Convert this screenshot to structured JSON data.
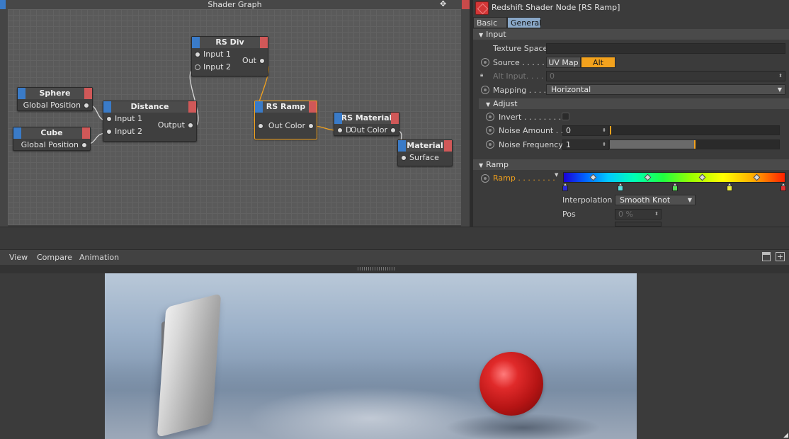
{
  "graph": {
    "title": "Shader Graph",
    "move_icon": "✥",
    "nodes": {
      "sphere": {
        "title": "Sphere",
        "out": "Global Position"
      },
      "cube": {
        "title": "Cube",
        "out": "Global Position"
      },
      "distance": {
        "title": "Distance",
        "in1": "Input 1",
        "in2": "Input 2",
        "out": "Output"
      },
      "rsdiv": {
        "title": "RS Div",
        "in1": "Input 1",
        "in2": "Input 2",
        "out": "Out"
      },
      "rsramp": {
        "title": "RS Ramp",
        "out": "Out Color"
      },
      "rsmaterial": {
        "title": "RS Material",
        "in": "D",
        "out": "Out Color"
      },
      "material": {
        "title": "Material",
        "in": "Surface"
      }
    },
    "colors": {
      "wire": "#d8d8d8",
      "selected_wire": "#f3a21d",
      "port_blue": "#3a7bc8",
      "port_red": "#d05858"
    }
  },
  "attributes": {
    "title": "Redshift Shader Node [RS Ramp]",
    "tabs": [
      "Basic",
      "General"
    ],
    "active_tab": "General",
    "input_section": "Input",
    "texture_space_label": "Texture Space",
    "source_label": "Source . . . . .",
    "source_options": [
      "UV Map",
      "Alt"
    ],
    "source_selected": "Alt",
    "alt_input_label": "Alt Input. . . .",
    "alt_input_value": "0",
    "mapping_label": "Mapping . . . .",
    "mapping_value": "Horizontal",
    "adjust_section": "Adjust",
    "invert_label": "Invert . . . . . . . . .",
    "noise_amount_label": "Noise Amount . .",
    "noise_amount_value": "0",
    "noise_amount_level": 0.0,
    "noise_freq_label": "Noise Frequency",
    "noise_freq_value": "1",
    "noise_freq_level": 0.5,
    "ramp_section": "Ramp",
    "ramp_label": "Ramp . . . . . . . .",
    "interpolation_label": "Interpolation",
    "interpolation_value": "Smooth Knot",
    "pos_label": "Pos",
    "pos_value": "0 %",
    "accent": "#f3a21d"
  },
  "viewer": {
    "menu": [
      "View",
      "Compare",
      "Animation"
    ]
  }
}
